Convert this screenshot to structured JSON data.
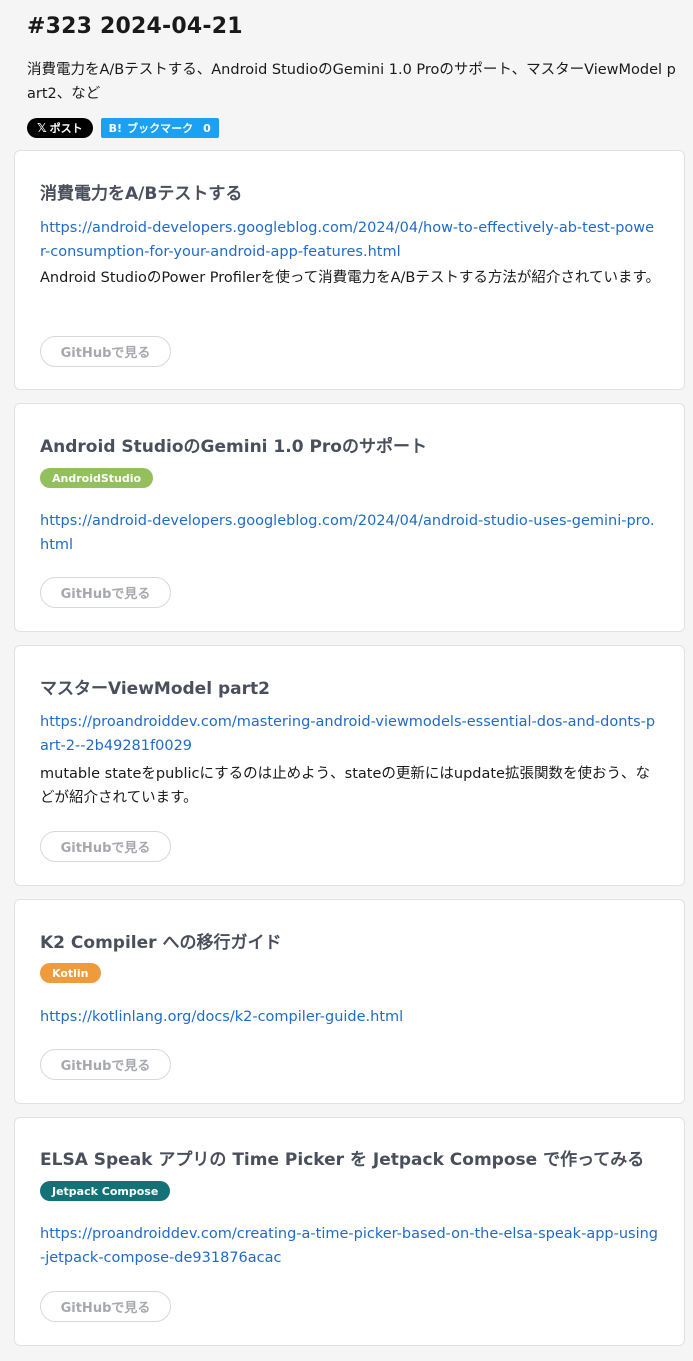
{
  "header": {
    "title": "#323 2024-04-21",
    "subtitle": "消費電力をA/Bテストする、Android StudioのGemini 1.0 Proのサポート、マスターViewModel part2、など"
  },
  "share": {
    "x_glyph": "𝕏",
    "x_label": "ポスト",
    "hatena_mark": "B!",
    "hatena_label": "ブックマーク",
    "hatena_count": "0"
  },
  "github_label": "GitHubで見る",
  "colors": {
    "tag_androidstudio": "#93bf5c",
    "tag_kotlin": "#ef9a3c",
    "tag_compose": "#137278",
    "link": "#1f6bc7"
  },
  "articles": [
    {
      "title": "消費電力をA/Bテストする",
      "url": "https://android-developers.googleblog.com/2024/04/how-to-effectively-ab-test-power-consumption-for-your-android-app-features.html",
      "description": "Android StudioのPower Profilerを使って消費電力をA/Bテストする方法が紹介されています。"
    },
    {
      "title": "Android StudioのGemini 1.0 Proのサポート",
      "tag": "AndroidStudio",
      "url": "https://android-developers.googleblog.com/2024/04/android-studio-uses-gemini-pro.html"
    },
    {
      "title": "マスターViewModel part2",
      "url": "https://proandroiddev.com/mastering-android-viewmodels-essential-dos-and-donts-part-2--2b49281f0029",
      "description": "mutable stateをpublicにするのは止めよう、stateの更新にはupdate拡張関数を使おう、などが紹介されています。"
    },
    {
      "title": "K2 Compiler への移行ガイド",
      "tag": "Kotlin",
      "url": "https://kotlinlang.org/docs/k2-compiler-guide.html"
    },
    {
      "title": "ELSA Speak アプリの Time Picker を Jetpack Compose で作ってみる",
      "tag": "Jetpack Compose",
      "url": "https://proandroiddev.com/creating-a-time-picker-based-on-the-elsa-speak-app-using-jetpack-compose-de931876acac"
    }
  ]
}
